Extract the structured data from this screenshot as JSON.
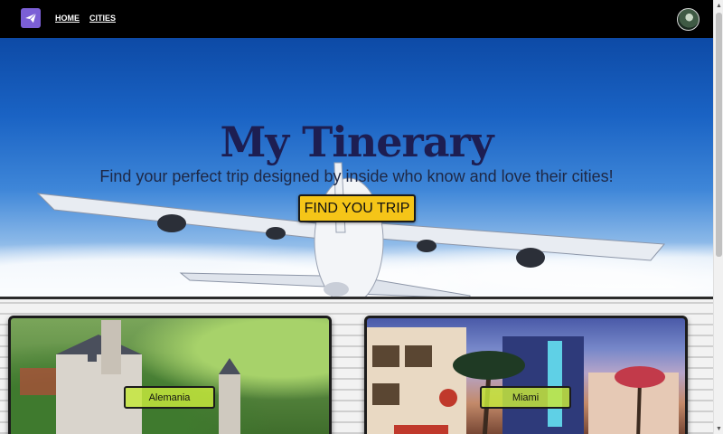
{
  "navbar": {
    "logo_icon": "paper-plane-icon",
    "links": [
      {
        "label": "HOME"
      },
      {
        "label": "CITIES"
      }
    ],
    "avatar_icon": "user-avatar"
  },
  "hero": {
    "title": "My Tinerary",
    "subtitle": "Find your perfect trip designed by inside who know and love their cities!",
    "cta_label": "FIND YOU TRIP"
  },
  "cities": [
    {
      "name": "Alemania"
    },
    {
      "name": "Miami"
    }
  ],
  "colors": {
    "navbar": "#000000",
    "title": "#1d1e52",
    "cta": "#f5c518",
    "card_label": "#c4e63c",
    "logo": "#7b5fd6"
  }
}
